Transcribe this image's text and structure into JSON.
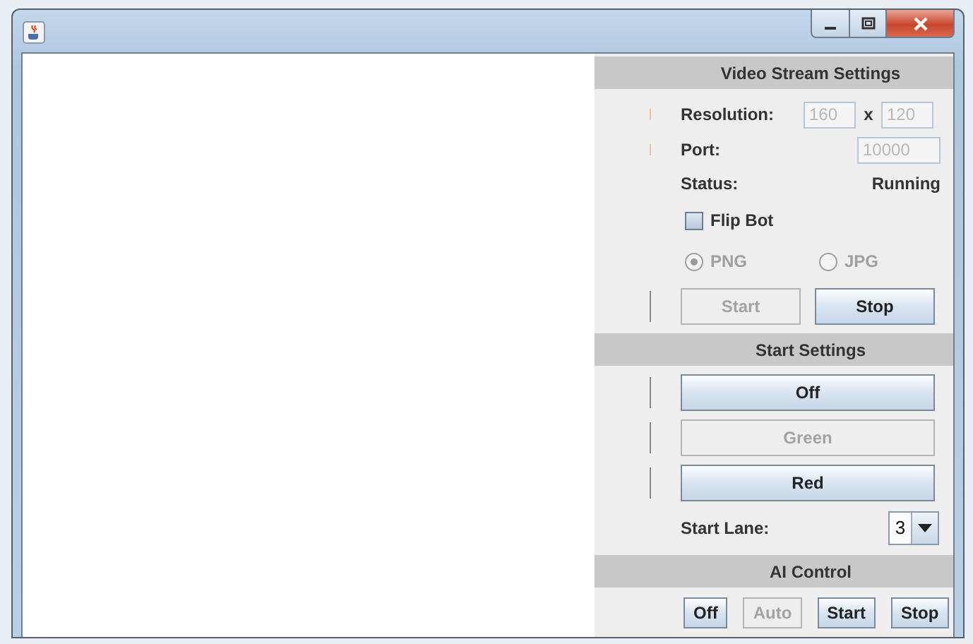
{
  "window": {
    "controls": [
      {
        "kind": "minimize"
      },
      {
        "kind": "maximize"
      },
      {
        "kind": "close"
      }
    ]
  },
  "video_stream_settings": {
    "header": "Video Stream Settings",
    "resolution": {
      "label": "Resolution:",
      "width": {
        "value": "160",
        "disabled": true
      },
      "separator": "x",
      "height": {
        "value": "120",
        "disabled": true
      }
    },
    "port": {
      "label": "Port:",
      "field": {
        "value": "10000",
        "disabled": true
      }
    },
    "status": {
      "label": "Status:",
      "value": "Running"
    },
    "flip_bot": {
      "label": "Flip Bot",
      "checked": false
    },
    "formats": [
      {
        "label": "PNG",
        "selected": true,
        "disabled": true
      },
      {
        "label": "JPG",
        "selected": false,
        "disabled": true
      }
    ],
    "buttons": [
      {
        "label": "Start",
        "disabled": true
      },
      {
        "label": "Stop",
        "disabled": false
      }
    ]
  },
  "start_settings": {
    "header": "Start Settings",
    "buttons": [
      {
        "label": "Off",
        "disabled": false
      },
      {
        "label": "Green",
        "disabled": true
      },
      {
        "label": "Red",
        "disabled": false
      }
    ],
    "start_lane": {
      "label": "Start Lane:",
      "value": "3"
    }
  },
  "ai_control": {
    "header": "AI Control",
    "buttons": [
      {
        "label": "Off",
        "disabled": false
      },
      {
        "label": "Auto",
        "disabled": true
      },
      {
        "label": "Start",
        "disabled": false
      },
      {
        "label": "Stop",
        "disabled": false
      }
    ]
  }
}
